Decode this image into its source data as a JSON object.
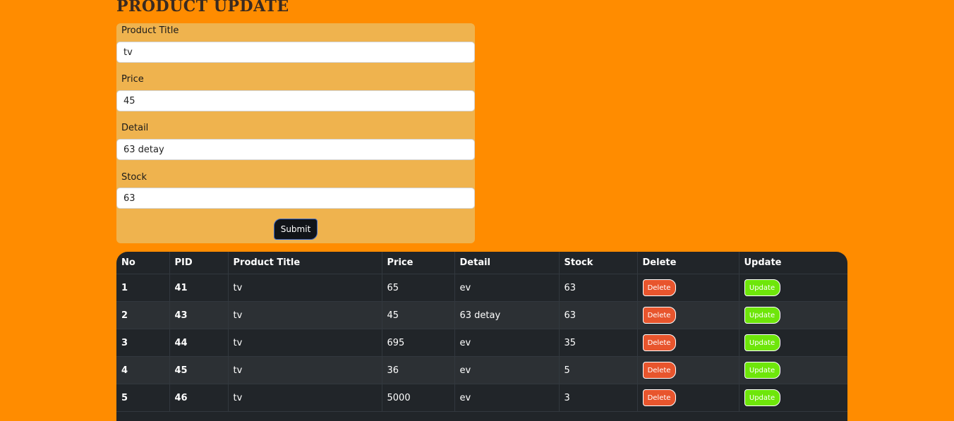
{
  "page": {
    "title": "Product Update"
  },
  "form": {
    "fields": [
      {
        "label": "Product Title",
        "value": "tv"
      },
      {
        "label": "Price",
        "value": "45"
      },
      {
        "label": "Detail",
        "value": "63 detay"
      },
      {
        "label": "Stock",
        "value": "63"
      }
    ],
    "submit_label": "Submit"
  },
  "table": {
    "headers": [
      "No",
      "PID",
      "Product Title",
      "Price",
      "Detail",
      "Stock",
      "Delete",
      "Update"
    ],
    "rows": [
      {
        "no": "1",
        "pid": "41",
        "title": "tv",
        "price": "65",
        "detail": "ev",
        "stock": "63",
        "delete": "Delete",
        "update": "Update"
      },
      {
        "no": "2",
        "pid": "43",
        "title": "tv",
        "price": "45",
        "detail": "63 detay",
        "stock": "63",
        "delete": "Delete",
        "update": "Update"
      },
      {
        "no": "3",
        "pid": "44",
        "title": "tv",
        "price": "695",
        "detail": "ev",
        "stock": "35",
        "delete": "Delete",
        "update": "Update"
      },
      {
        "no": "4",
        "pid": "45",
        "title": "tv",
        "price": "36",
        "detail": "ev",
        "stock": "5",
        "delete": "Delete",
        "update": "Update"
      },
      {
        "no": "5",
        "pid": "46",
        "title": "tv",
        "price": "5000",
        "detail": "ev",
        "stock": "3",
        "delete": "Delete",
        "update": "Update"
      }
    ]
  },
  "colors": {
    "background": "#ff8c00",
    "form_card": "#efb34e",
    "table_bg": "#212529",
    "delete": "#e8552d",
    "update": "#6ee60a"
  }
}
